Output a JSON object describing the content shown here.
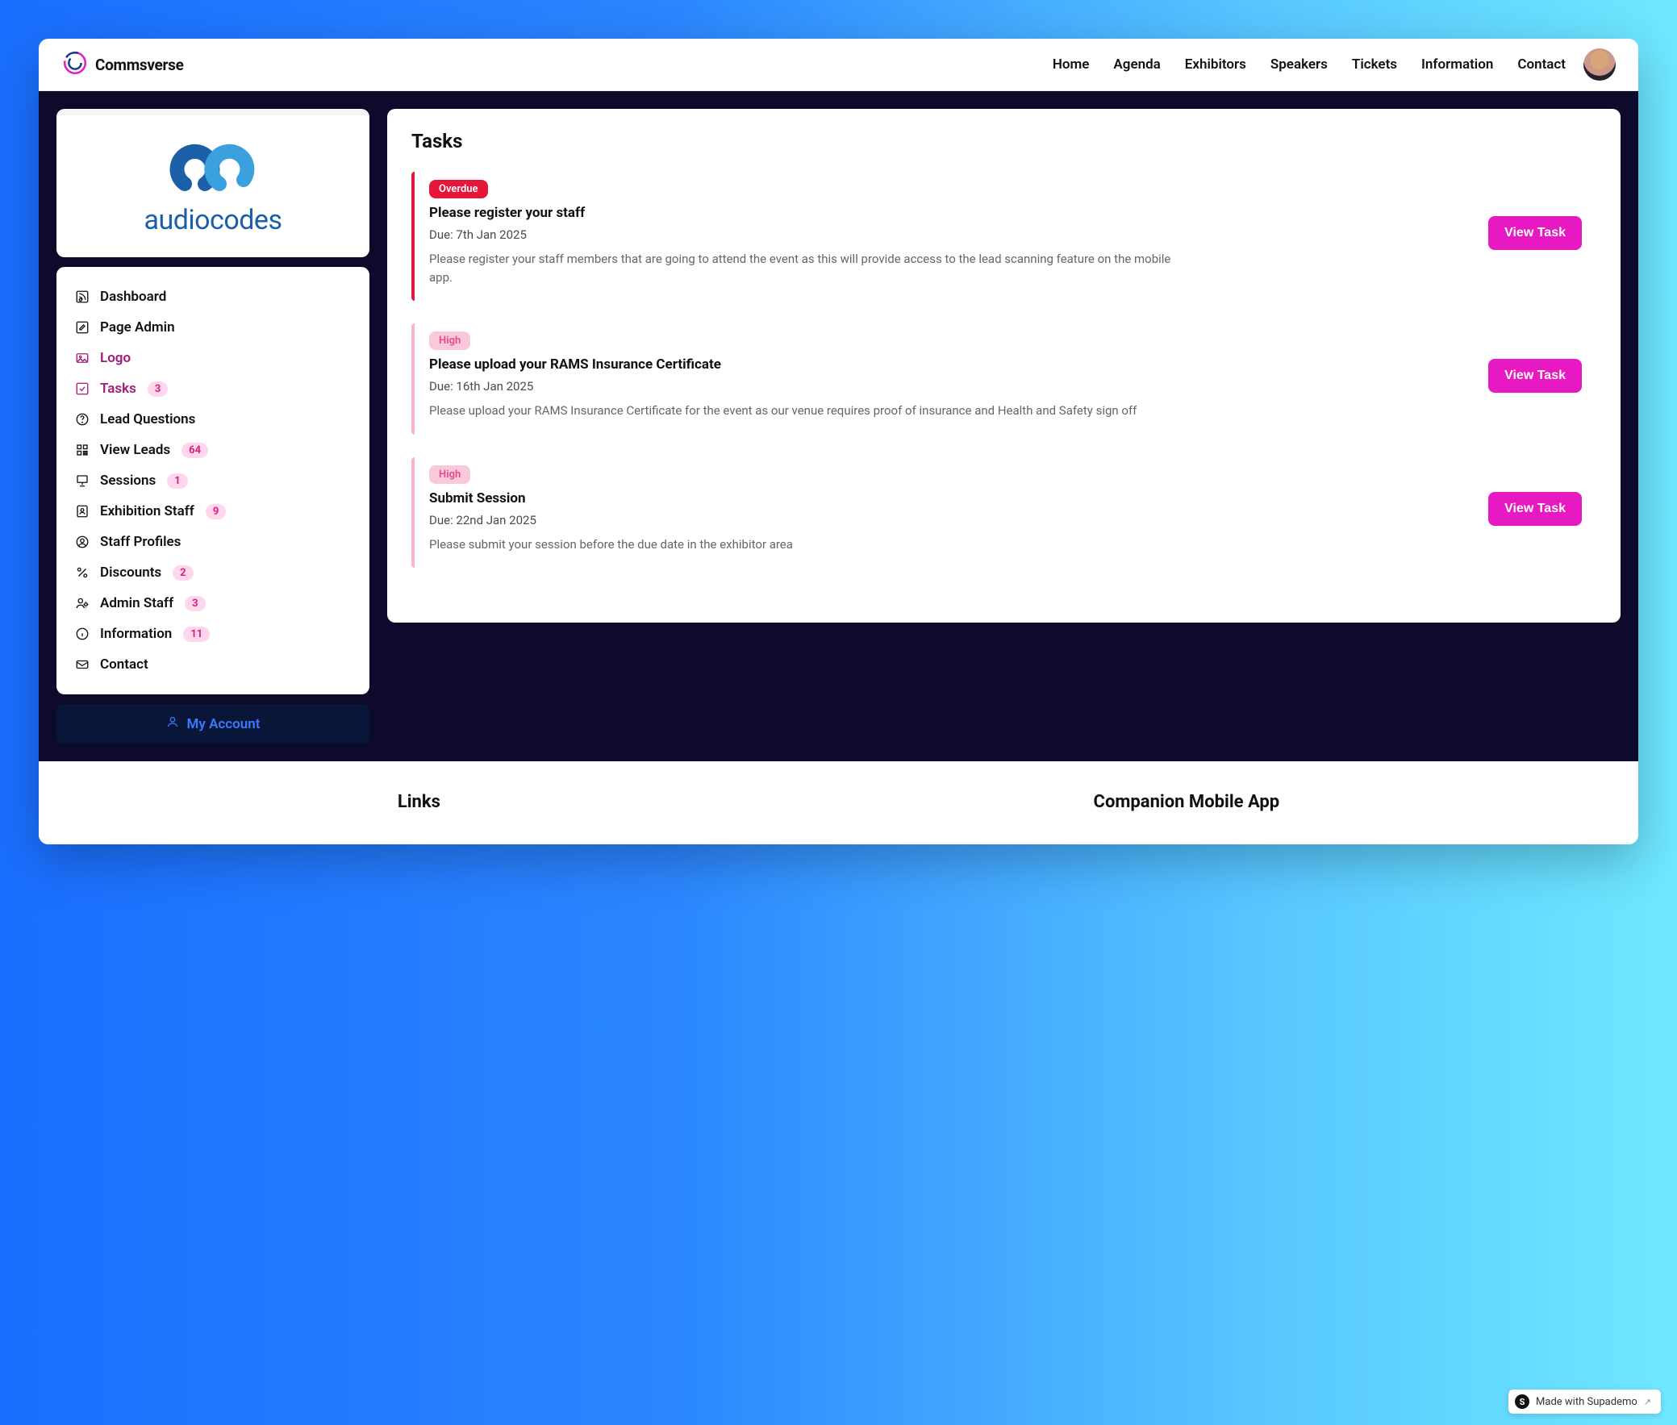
{
  "brand": {
    "name": "Commsverse"
  },
  "nav": {
    "links": [
      "Home",
      "Agenda",
      "Exhibitors",
      "Speakers",
      "Tickets",
      "Information",
      "Contact"
    ]
  },
  "sidebar": {
    "company_name": "audiocodes",
    "items": [
      {
        "label": "Dashboard",
        "icon": "rss",
        "badge": null,
        "active": false
      },
      {
        "label": "Page Admin",
        "icon": "edit",
        "badge": null,
        "active": false
      },
      {
        "label": "Logo",
        "icon": "image",
        "badge": null,
        "active": true
      },
      {
        "label": "Tasks",
        "icon": "check-square",
        "badge": "3",
        "active": true
      },
      {
        "label": "Lead Questions",
        "icon": "help",
        "badge": null,
        "active": false
      },
      {
        "label": "View Leads",
        "icon": "qr",
        "badge": "64",
        "active": false
      },
      {
        "label": "Sessions",
        "icon": "presentation",
        "badge": "1",
        "active": false
      },
      {
        "label": "Exhibition Staff",
        "icon": "id",
        "badge": "9",
        "active": false
      },
      {
        "label": "Staff Profiles",
        "icon": "user",
        "badge": null,
        "active": false
      },
      {
        "label": "Discounts",
        "icon": "percent",
        "badge": "2",
        "active": false
      },
      {
        "label": "Admin Staff",
        "icon": "admin",
        "badge": "3",
        "active": false
      },
      {
        "label": "Information",
        "icon": "info",
        "badge": "11",
        "active": false
      },
      {
        "label": "Contact",
        "icon": "mail",
        "badge": null,
        "active": false
      }
    ],
    "account_button": "My Account"
  },
  "main": {
    "title": "Tasks",
    "tasks": [
      {
        "priority": "Overdue",
        "priority_class": "overdue",
        "title": "Please register your staff",
        "due": "Due: 7th Jan 2025",
        "desc": "Please register your staff members that are going to attend the event as this will provide access to the lead scanning feature on the mobile app.",
        "button": "View Task"
      },
      {
        "priority": "High",
        "priority_class": "high",
        "title": "Please upload your RAMS Insurance Certificate",
        "due": "Due: 16th Jan 2025",
        "desc": "Please upload your RAMS Insurance Certificate for the event as our venue requires proof of insurance and Health and Safety sign off",
        "button": "View Task"
      },
      {
        "priority": "High",
        "priority_class": "high",
        "title": "Submit Session",
        "due": "Due: 22nd Jan 2025",
        "desc": "Please submit your session before the due date in the exhibitor area",
        "button": "View Task"
      }
    ]
  },
  "footer": {
    "col1": "Links",
    "col2": "Companion Mobile App"
  },
  "supademo": {
    "label": "Made with Supademo"
  }
}
